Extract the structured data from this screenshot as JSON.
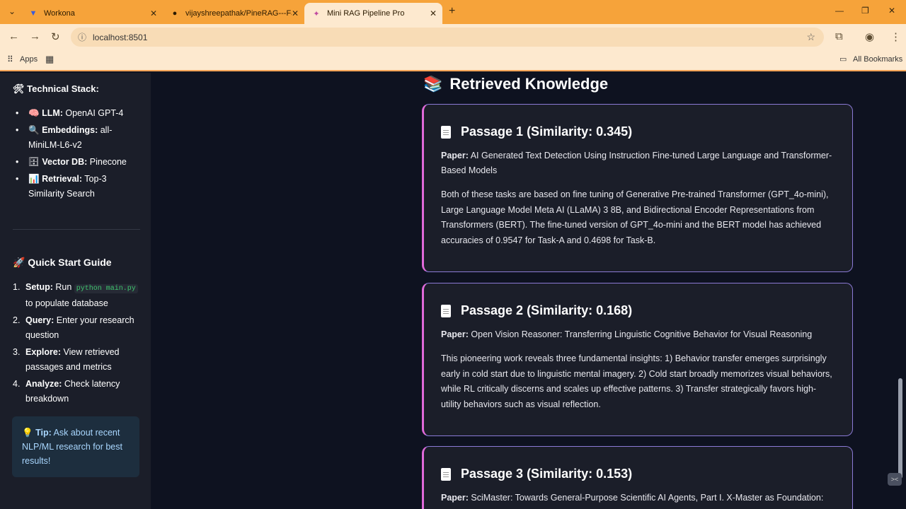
{
  "browser": {
    "tabs": [
      {
        "title": "Workona",
        "icon": "workona-icon"
      },
      {
        "title": "vijayshreepathak/PineRAG---Fa",
        "icon": "github-icon"
      },
      {
        "title": "Mini RAG Pipeline Pro",
        "icon": "rag-icon"
      }
    ],
    "url": "localhost:8501",
    "bookmarks": {
      "apps": "Apps",
      "all": "All Bookmarks"
    }
  },
  "sidebar": {
    "tech_title": "Technical Stack:",
    "tech": [
      {
        "label": "LLM:",
        "value": "OpenAI GPT-4"
      },
      {
        "label": "Embeddings:",
        "value": "all-MiniLM-L6-v2"
      },
      {
        "label": "Vector DB:",
        "value": "Pinecone"
      },
      {
        "label": "Retrieval:",
        "value": "Top-3 Similarity Search"
      }
    ],
    "guide_title": "Quick Start Guide",
    "guide": [
      {
        "num": "1.",
        "label": "Setup:",
        "pre": "Run",
        "code": "python main.py",
        "post": "to populate database"
      },
      {
        "num": "2.",
        "label": "Query:",
        "value": "Enter your research question"
      },
      {
        "num": "3.",
        "label": "Explore:",
        "value": "View retrieved passages and metrics"
      },
      {
        "num": "4.",
        "label": "Analyze:",
        "value": "Check latency breakdown"
      }
    ],
    "tip_label": "Tip:",
    "tip_text": "Ask about recent NLP/ML research for best results!"
  },
  "main": {
    "title": "Retrieved Knowledge",
    "paper_label": "Paper:",
    "passages": [
      {
        "title": "Passage 1 (Similarity: 0.345)",
        "paper": "AI Generated Text Detection Using Instruction Fine-tuned Large Language and Transformer-Based Models",
        "text": "Both of these tasks are based on fine tuning of Generative Pre-trained Transformer (GPT_4o-mini), Large Language Model Meta AI (LLaMA) 3 8B, and Bidirectional Encoder Representations from Transformers (BERT). The fine-tuned version of GPT_4o-mini and the BERT model has achieved accuracies of 0.9547 for Task-A and 0.4698 for Task-B."
      },
      {
        "title": "Passage 2 (Similarity: 0.168)",
        "paper": "Open Vision Reasoner: Transferring Linguistic Cognitive Behavior for Visual Reasoning",
        "text": "This pioneering work reveals three fundamental insights: 1) Behavior transfer emerges surprisingly early in cold start due to linguistic mental imagery. 2) Cold start broadly memorizes visual behaviors, while RL critically discerns and scales up effective patterns. 3) Transfer strategically favors high-utility behaviors such as visual reflection."
      },
      {
        "title": "Passage 3 (Similarity: 0.153)",
        "paper": "SciMaster: Towards General-Purpose Scientific AI Agents, Part I. X-Master as Foundation: Can",
        "text": ""
      }
    ]
  }
}
